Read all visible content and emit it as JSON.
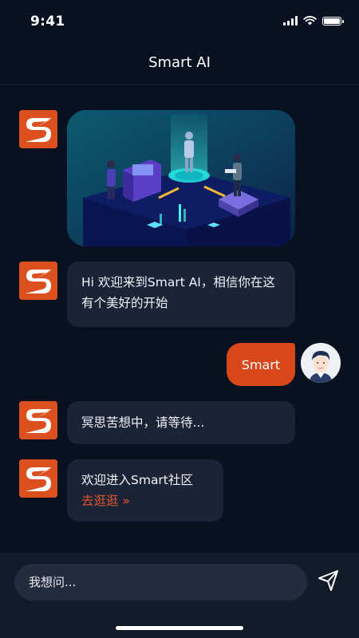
{
  "status_bar": {
    "time": "9:41"
  },
  "header": {
    "title": "Smart AI"
  },
  "messages": [
    {
      "sender": "ai",
      "type": "image"
    },
    {
      "sender": "ai",
      "text": "Hi 欢迎来到Smart AI，相信你在这有个美好的开始"
    },
    {
      "sender": "user",
      "text": "Smart"
    },
    {
      "sender": "ai",
      "text": "冥思苦想中，请等待..."
    },
    {
      "sender": "ai",
      "text": "欢迎进入Smart社区",
      "link": "去逛逛 »"
    }
  ],
  "composer": {
    "placeholder": "我想问..."
  },
  "colors": {
    "accent": "#d9481a",
    "background": "#081120",
    "bubble": "#1a2436"
  },
  "icons": {
    "send": "send-icon",
    "ai_avatar": "smart-logo-icon"
  }
}
